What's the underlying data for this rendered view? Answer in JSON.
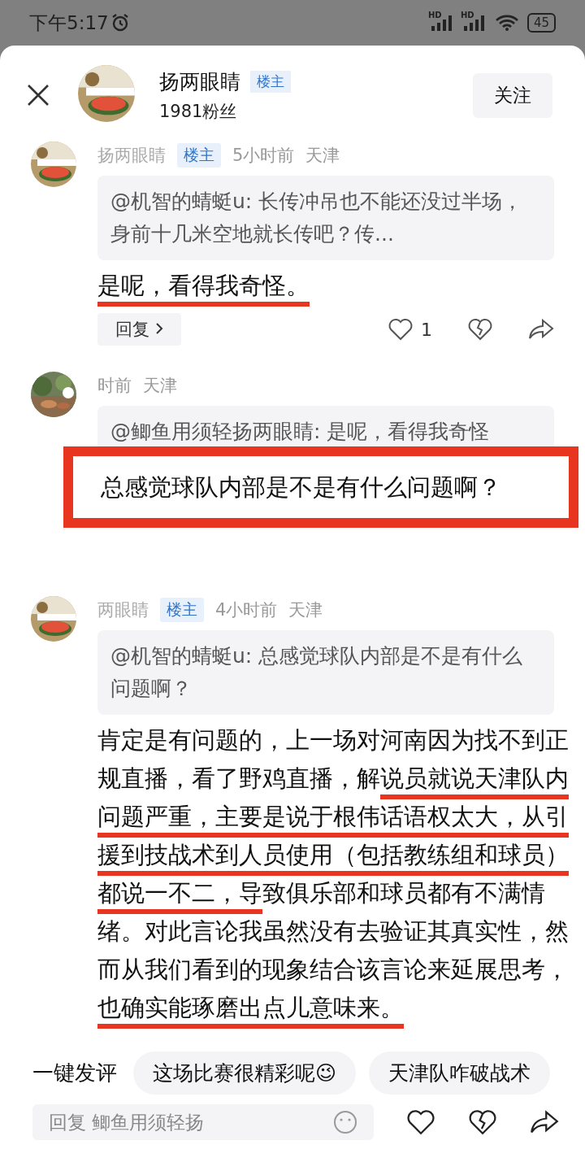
{
  "status_bar": {
    "time": "下午5:17",
    "network_labels": [
      "HD",
      "HD"
    ],
    "battery": "45"
  },
  "header": {
    "name": "扬两眼睛",
    "badge": "楼主",
    "followers": "1981粉丝",
    "follow_button": "关注"
  },
  "comments": [
    {
      "name": "扬两眼睛",
      "badge": "楼主",
      "time": "5小时前",
      "location": "天津",
      "quote": "@机智的蜻蜓u: 长传冲吊也不能还没过半场，身前十几米空地就长传吧？传...",
      "body": [
        {
          "text": "是呢，看得我奇怪。",
          "underlined": true
        }
      ],
      "boxed": false,
      "reply": "回复",
      "likes": "1"
    },
    {
      "time": "时前",
      "location": "天津",
      "quote": "@鲫鱼用须轻扬两眼睛: 是呢，看得我奇怪",
      "body": [
        {
          "text": "总感觉球队内部是不是有什么问题啊？",
          "underlined": false
        }
      ],
      "boxed": true
    },
    {
      "name": "两眼睛",
      "badge": "楼主",
      "time": "4小时前",
      "location": "天津",
      "quote": "@机智的蜻蜓u: 总感觉球队内部是不是有什么问题啊？",
      "body": [
        {
          "text": "肯定是有问题的，上一场对河南因为找不到正规直播，看了野鸡直播，解",
          "underlined": false
        },
        {
          "text": "说员就说天津队内问题严重，主要是说于根伟话语权太大，从引援到技战术到人员使用（包括教练组和球员）都说一不二，导",
          "underlined": true
        },
        {
          "text": "致俱乐部和球员都有不满情绪。对此言论我虽然没有去验证其真实性，然而从我们看到的现象结合该言论来延展思考，",
          "underlined": false
        },
        {
          "text": "也确实能琢磨出点儿意味来。",
          "underlined": true
        }
      ],
      "boxed": false
    }
  ],
  "quick_comments": {
    "label": "一键发评",
    "chips": [
      "这场比赛很精彩呢😉",
      "天津队咋破战术"
    ]
  },
  "reply_bar": {
    "placeholder": "回复 鲫鱼用须轻扬"
  }
}
